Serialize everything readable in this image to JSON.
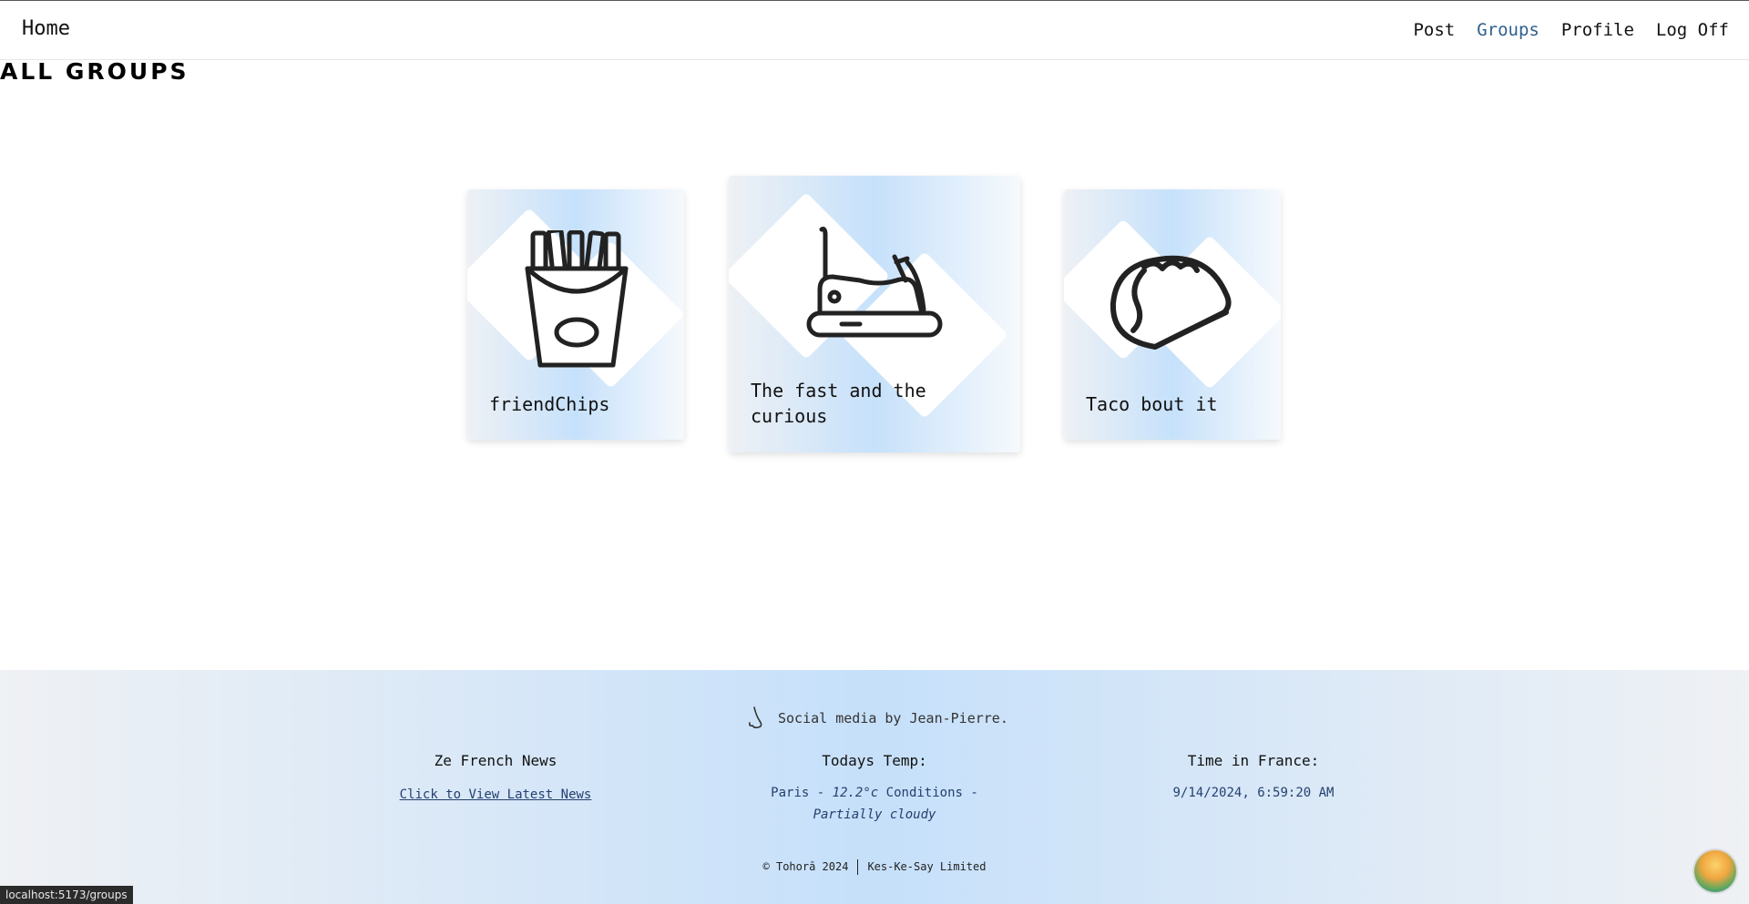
{
  "navbar": {
    "brand": "Home",
    "links": [
      {
        "label": "Post",
        "active": false
      },
      {
        "label": "Groups",
        "active": true
      },
      {
        "label": "Profile",
        "active": false
      },
      {
        "label": "Log Off",
        "active": false
      }
    ]
  },
  "page": {
    "title": "ALL GROUPS"
  },
  "groups": [
    {
      "name": "friendChips",
      "icon": "french-fries-icon"
    },
    {
      "name": "The fast and the curious",
      "icon": "bumper-car-icon"
    },
    {
      "name": "Taco bout it",
      "icon": "taco-icon"
    }
  ],
  "footer": {
    "tagline": "Social media by Jean-Pierre.",
    "tagline_icon": "nose-icon",
    "news": {
      "heading": "Ze French News",
      "link": "Click to View Latest News"
    },
    "temp": {
      "heading": "Todays Temp:",
      "city": "Paris",
      "dash1": "-",
      "temperature": "12.2°c",
      "conditions_label": "Conditions",
      "dash2": "-",
      "conditions": "Partially cloudy"
    },
    "time": {
      "heading": "Time in France:",
      "value": "9/14/2024, 6:59:20 AM"
    },
    "copyright_left": "© Tohorā 2024",
    "copyright_right": "Kes-Ke-Say Limited"
  },
  "status_bar": {
    "url": "localhost:5173/groups"
  },
  "colors": {
    "accent": "#2f5f8e",
    "footer_text": "#24406e",
    "card_gradient": "#c6e1fb"
  }
}
